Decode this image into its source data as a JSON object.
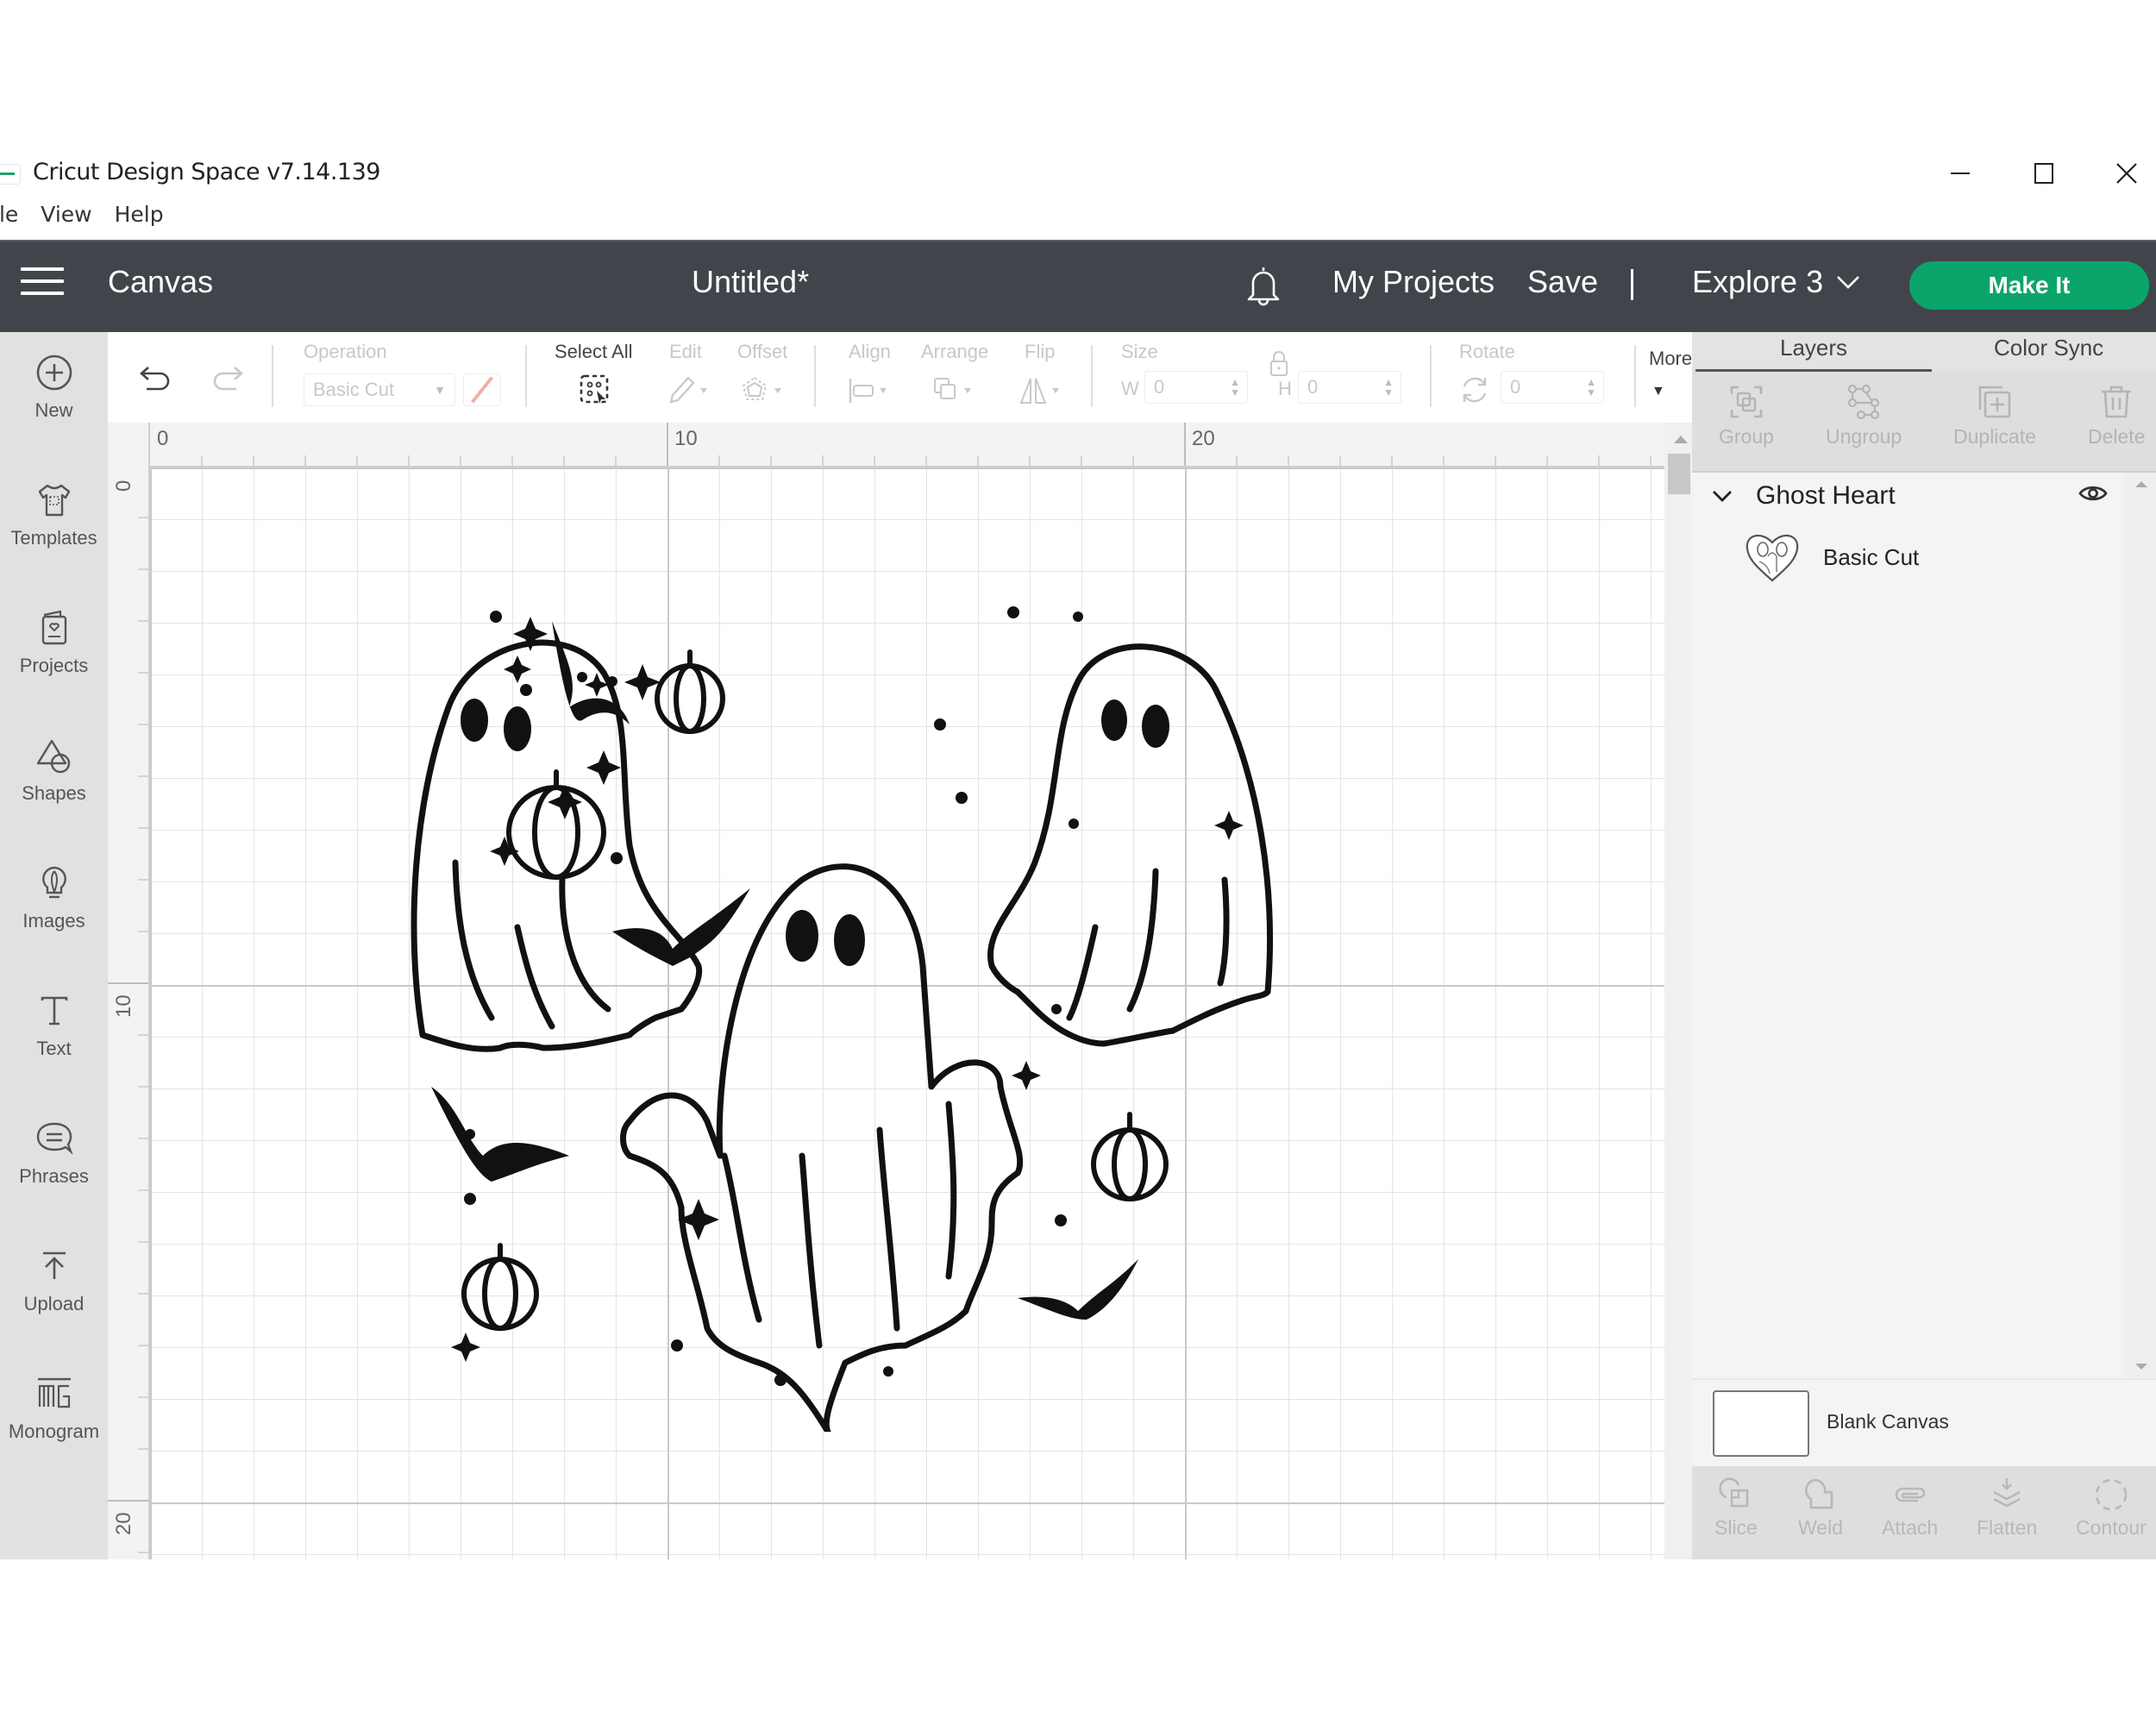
{
  "window": {
    "title": "Cricut Design Space  v7.14.139",
    "controls": {
      "minimize": "minimize",
      "maximize": "maximize",
      "close": "close"
    }
  },
  "menubar": [
    "ile",
    "View",
    "Help"
  ],
  "header": {
    "section": "Canvas",
    "document_title": "Untitled*",
    "my_projects": "My Projects",
    "save": "Save",
    "separator": "|",
    "machine": "Explore 3",
    "make_it": "Make It",
    "accent_color": "#0ba56a"
  },
  "sidebar": {
    "items": [
      {
        "label": "New",
        "icon": "plus-circle-icon"
      },
      {
        "label": "Templates",
        "icon": "tshirt-icon"
      },
      {
        "label": "Projects",
        "icon": "project-card-icon"
      },
      {
        "label": "Shapes",
        "icon": "shapes-icon"
      },
      {
        "label": "Images",
        "icon": "lightbulb-icon"
      },
      {
        "label": "Text",
        "icon": "text-icon"
      },
      {
        "label": "Phrases",
        "icon": "speech-bubble-icon"
      },
      {
        "label": "Upload",
        "icon": "upload-icon"
      },
      {
        "label": "Monogram",
        "icon": "monogram-icon"
      }
    ]
  },
  "toolbar": {
    "operation_label": "Operation",
    "operation_value": "Basic Cut",
    "select_all": "Select All",
    "edit": "Edit",
    "offset": "Offset",
    "align": "Align",
    "arrange": "Arrange",
    "flip": "Flip",
    "size": "Size",
    "w_label": "W",
    "w_value": "0",
    "h_label": "H",
    "h_value": "0",
    "rotate": "Rotate",
    "rotate_value": "0",
    "more": "More"
  },
  "rulers": {
    "horizontal": [
      "0",
      "10",
      "20"
    ],
    "vertical": [
      "0",
      "10",
      "20"
    ]
  },
  "canvas": {
    "design_name": "Ghost Heart"
  },
  "right_panel": {
    "tabs": [
      "Layers",
      "Color Sync"
    ],
    "active_tab": "Layers",
    "layer_actions": [
      "Group",
      "Ungroup",
      "Duplicate",
      "Delete"
    ],
    "layer_group": {
      "name": "Ghost Heart",
      "visible": true,
      "children": [
        {
          "label": "Basic Cut"
        }
      ]
    },
    "blank_canvas": "Blank Canvas",
    "bottom_actions": [
      "Slice",
      "Weld",
      "Attach",
      "Flatten",
      "Contour"
    ]
  }
}
